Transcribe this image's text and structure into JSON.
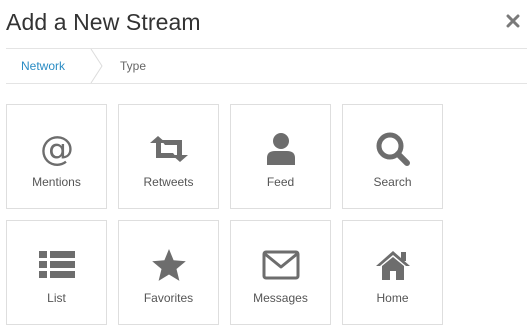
{
  "dialog": {
    "title": "Add a New Stream",
    "close_icon": "close-icon"
  },
  "breadcrumb": {
    "steps": [
      {
        "label": "Network",
        "active": true
      },
      {
        "label": "Type",
        "active": false
      }
    ]
  },
  "colors": {
    "accent": "#2a8cc4",
    "icon": "#6d6d6d",
    "tile_border": "#dedede",
    "divider": "#e4e4e4"
  },
  "stream_types": [
    {
      "label": "Mentions",
      "icon": "at-icon"
    },
    {
      "label": "Retweets",
      "icon": "retweet-icon"
    },
    {
      "label": "Feed",
      "icon": "user-icon"
    },
    {
      "label": "Search",
      "icon": "search-icon"
    },
    {
      "label": "List",
      "icon": "list-icon"
    },
    {
      "label": "Favorites",
      "icon": "star-icon"
    },
    {
      "label": "Messages",
      "icon": "envelope-icon"
    },
    {
      "label": "Home",
      "icon": "home-icon"
    }
  ]
}
